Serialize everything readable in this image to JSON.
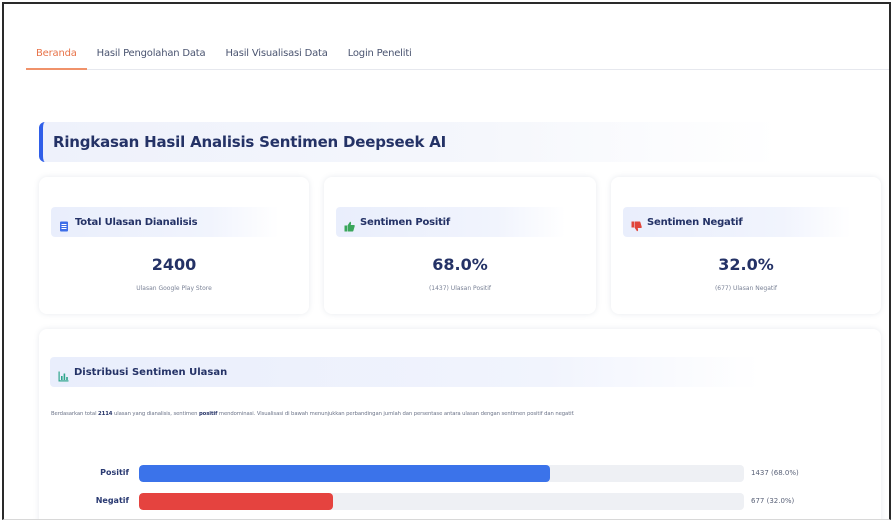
{
  "colors": {
    "accent_tab": "#e8744a",
    "primary_blue": "#2f5ee8",
    "positive_bar": "#3b73ea",
    "negative_bar": "#e5433f",
    "heading_text": "#243266"
  },
  "tabs": [
    {
      "label": "Beranda",
      "active": true
    },
    {
      "label": "Hasil Pengolahan Data",
      "active": false
    },
    {
      "label": "Hasil Visualisasi Data",
      "active": false
    },
    {
      "label": "Login Peneliti",
      "active": false
    }
  ],
  "summary": {
    "title": "Ringkasan Hasil Analisis Sentimen Deepseek AI"
  },
  "cards": {
    "total": {
      "icon": "document-icon",
      "label": "Total Ulasan Dianalisis",
      "value": "2400",
      "sub": "Ulasan Google Play Store"
    },
    "positive": {
      "icon": "thumbs-up-icon",
      "label": "Sentimen Positif",
      "value": "68.0%",
      "sub": "(1437) Ulasan Positif"
    },
    "negative": {
      "icon": "thumbs-down-icon",
      "label": "Sentimen Negatif",
      "value": "32.0%",
      "sub": "(677) Ulasan Negatif"
    }
  },
  "distribution": {
    "icon": "bar-chart-icon",
    "title": "Distribusi Sentimen Ulasan",
    "desc_prefix": "Berdasarkan total",
    "desc_count": "2114",
    "desc_mid": "ulasan yang dianalisis, sentimen",
    "desc_strong": "positif",
    "desc_suffix": "mendominasi. Visualisasi di bawah menunjukkan perbandingan jumlah dan persentase antara ulasan dengan sentimen positif dan negatif.",
    "rows": [
      {
        "label": "Positif",
        "value_text": "1437 (68.0%)",
        "fraction": 0.68,
        "color": "#3b73ea"
      },
      {
        "label": "Negatif",
        "value_text": "677 (32.0%)",
        "fraction": 0.32,
        "color": "#e5433f"
      }
    ]
  }
}
